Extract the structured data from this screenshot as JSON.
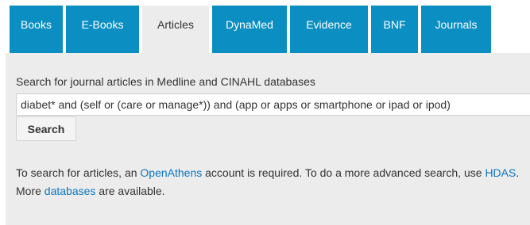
{
  "tabs": [
    {
      "label": "Books",
      "active": false
    },
    {
      "label": "E-Books",
      "active": false
    },
    {
      "label": "Articles",
      "active": true
    },
    {
      "label": "DynaMed",
      "active": false
    },
    {
      "label": "Evidence",
      "active": false
    },
    {
      "label": "BNF",
      "active": false
    },
    {
      "label": "Journals",
      "active": false
    }
  ],
  "search": {
    "label": "Search for journal articles in Medline and CINAHL databases",
    "value": "diabet* and (self or (care or manage*)) and (app or apps or smartphone or ipad or ipod)",
    "button_label": "Search"
  },
  "info": {
    "text1": "To search for articles, an ",
    "link_openathens": "OpenAthens",
    "text2": " account is required. To do a more advanced search, use ",
    "link_hdas": "HDAS",
    "text3": ". More ",
    "link_databases": "databases",
    "text4": " are available."
  },
  "colors": {
    "tab_background": "#0b8ec2",
    "panel_background": "#ececec",
    "link": "#0b77c0"
  }
}
